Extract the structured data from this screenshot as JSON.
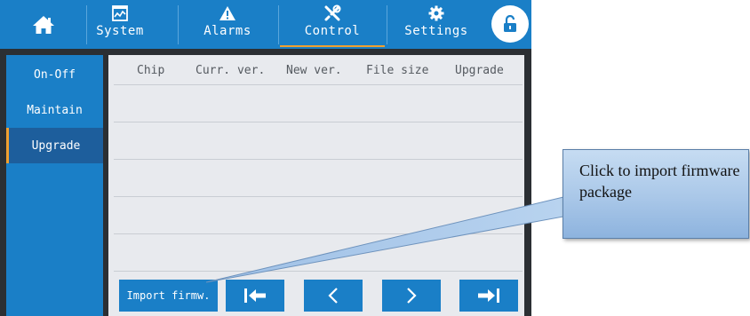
{
  "nav": {
    "home_icon": "home-icon",
    "tabs": [
      {
        "label": "System",
        "icon": "system-chart-icon"
      },
      {
        "label": "Alarms",
        "icon": "warning-icon"
      },
      {
        "label": "Control",
        "icon": "tools-icon",
        "active": true
      },
      {
        "label": "Settings",
        "icon": "gear-icon"
      }
    ],
    "lock_icon": "unlock-icon"
  },
  "sidebar": {
    "items": [
      {
        "label": "On-Off"
      },
      {
        "label": "Maintain"
      },
      {
        "label": "Upgrade",
        "active": true
      }
    ]
  },
  "table": {
    "columns": [
      "Chip",
      "Curr. ver.",
      "New ver.",
      "File size",
      "Upgrade"
    ],
    "rows": []
  },
  "buttons": {
    "import_label": "Import firmw.",
    "first_icon": "first-page-icon",
    "prev_icon": "previous-page-icon",
    "next_icon": "next-page-icon",
    "last_icon": "last-page-icon"
  },
  "callout": {
    "text": "Click to import firmware package"
  },
  "colors": {
    "primary": "#1a7fc7",
    "accent": "#f0a030",
    "panel": "#e8eaee"
  }
}
